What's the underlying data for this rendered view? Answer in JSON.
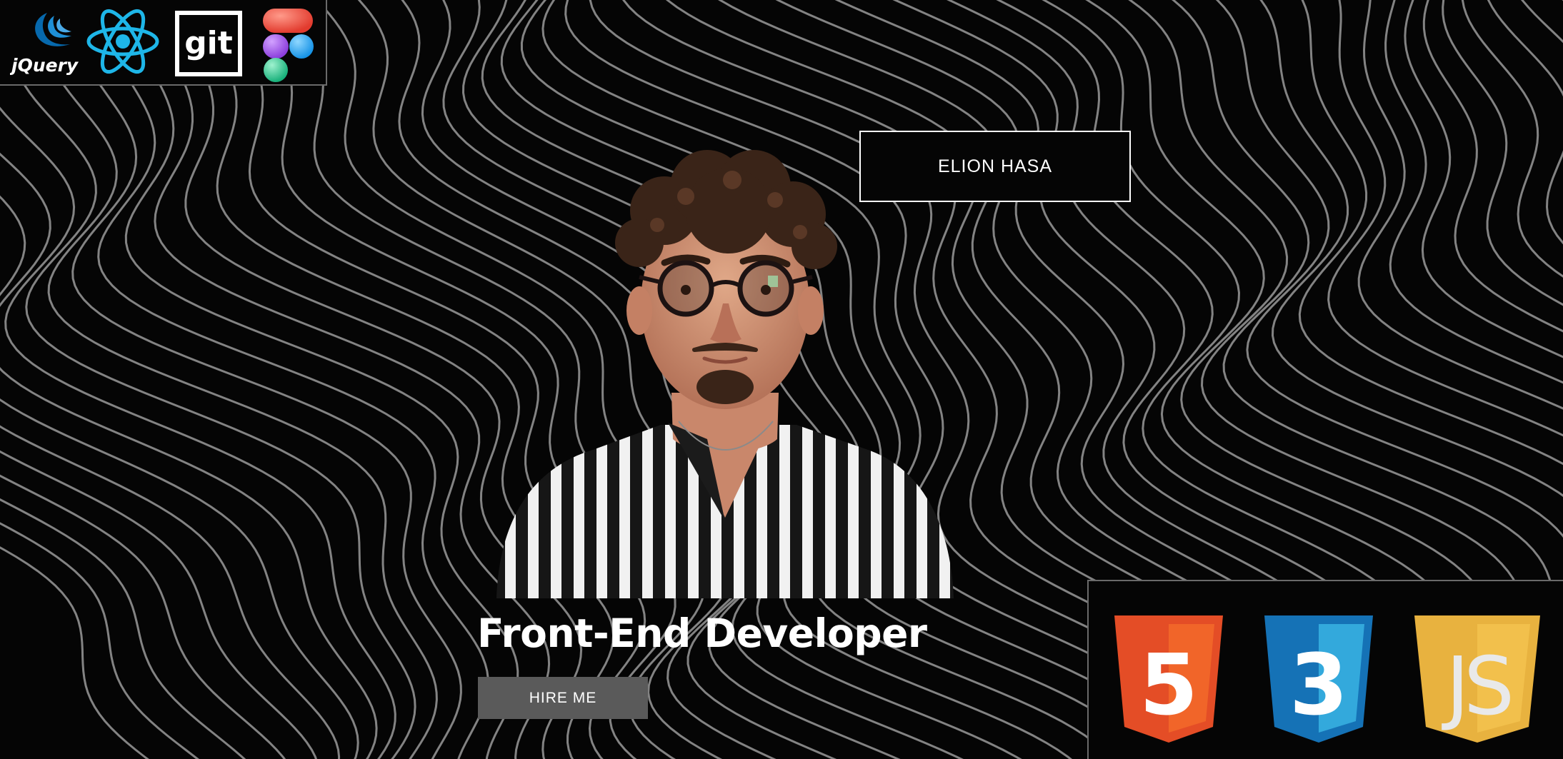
{
  "header": {
    "name": "ELION HASA"
  },
  "hero": {
    "title": "Front-End Developer",
    "cta_label": "HIRE ME"
  },
  "tech_top": [
    {
      "icon": "jquery-icon",
      "label": "jQuery"
    },
    {
      "icon": "react-icon"
    },
    {
      "icon": "git-icon",
      "label": "git"
    },
    {
      "icon": "figma-icon"
    }
  ],
  "tech_bottom": [
    {
      "icon": "html5-icon",
      "label": "5"
    },
    {
      "icon": "css3-icon",
      "label": "3"
    },
    {
      "icon": "javascript-icon",
      "label": "JS"
    }
  ],
  "colors": {
    "background": "#050505",
    "lines": "#9a9a9a",
    "html5": "#e44d26",
    "css3": "#1572b6",
    "javascript": "#e8b23f",
    "react": "#1eb6e8",
    "jquery": "#0769ad",
    "button": "#5a5a5a"
  }
}
